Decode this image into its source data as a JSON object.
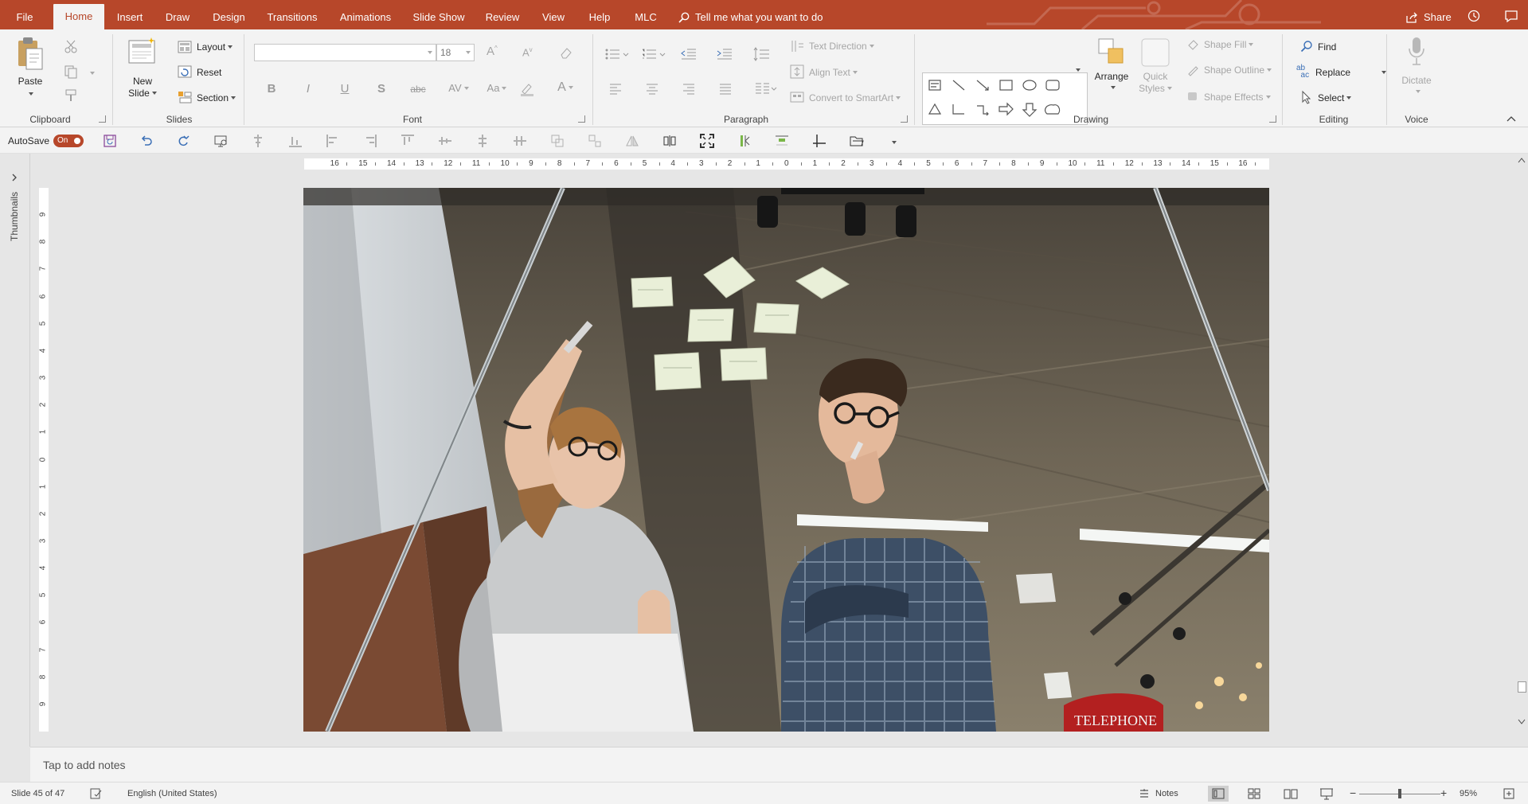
{
  "tabs": [
    {
      "label": "File",
      "active": false
    },
    {
      "label": "Home",
      "active": true
    },
    {
      "label": "Insert",
      "active": false
    },
    {
      "label": "Draw",
      "active": false
    },
    {
      "label": "Design",
      "active": false
    },
    {
      "label": "Transitions",
      "active": false
    },
    {
      "label": "Animations",
      "active": false
    },
    {
      "label": "Slide Show",
      "active": false
    },
    {
      "label": "Review",
      "active": false
    },
    {
      "label": "View",
      "active": false
    },
    {
      "label": "Help",
      "active": false
    },
    {
      "label": "MLC",
      "active": false
    }
  ],
  "tell_me": "Tell me what you want to do",
  "share": "Share",
  "ribbon": {
    "clipboard": {
      "label": "Clipboard",
      "paste": "Paste"
    },
    "slides": {
      "label": "Slides",
      "new_slide_1": "New",
      "new_slide_2": "Slide",
      "layout": "Layout",
      "reset": "Reset",
      "section": "Section"
    },
    "font": {
      "label": "Font",
      "font_name": "",
      "font_size": "18",
      "bold": "B",
      "italic": "I",
      "underline": "U",
      "shadow": "S",
      "strike": "abc",
      "spacing": "AV",
      "case": "Aa",
      "color": "A"
    },
    "paragraph": {
      "label": "Paragraph",
      "text_direction": "Text Direction",
      "align_text": "Align Text",
      "convert_smartart": "Convert to SmartArt"
    },
    "drawing": {
      "label": "Drawing",
      "arrange": "Arrange",
      "quick_styles_1": "Quick",
      "quick_styles_2": "Styles",
      "shape_fill": "Shape Fill",
      "shape_outline": "Shape Outline",
      "shape_effects": "Shape Effects"
    },
    "editing": {
      "label": "Editing",
      "find": "Find",
      "replace": "Replace",
      "select": "Select"
    },
    "voice": {
      "label": "Voice",
      "dictate": "Dictate"
    }
  },
  "qat": {
    "autosave_label": "AutoSave",
    "autosave_state": "On"
  },
  "ruler": {
    "h_labels": [
      "16",
      "15",
      "14",
      "13",
      "12",
      "11",
      "10",
      "9",
      "8",
      "7",
      "6",
      "5",
      "4",
      "3",
      "2",
      "1",
      "0",
      "1",
      "2",
      "3",
      "4",
      "5",
      "6",
      "7",
      "8",
      "9",
      "10",
      "11",
      "12",
      "13",
      "14",
      "15",
      "16"
    ],
    "v_labels": [
      "9",
      "8",
      "7",
      "6",
      "5",
      "4",
      "3",
      "2",
      "1",
      "0",
      "1",
      "2",
      "3",
      "4",
      "5",
      "6",
      "7",
      "8",
      "9"
    ]
  },
  "thumbnails_label": "Thumbnails",
  "slide": {
    "sign_text": "TELEPHONE"
  },
  "notes_placeholder": "Tap to add notes",
  "status": {
    "slide_counter": "Slide 45 of 47",
    "language": "English (United States)",
    "notes": "Notes",
    "zoom": "95%",
    "zoom_fraction": 0.5
  },
  "colors": {
    "accent": "#b7472a",
    "ribbon_bg": "#f3f3f3",
    "workspace_bg": "#e6e6e6"
  }
}
